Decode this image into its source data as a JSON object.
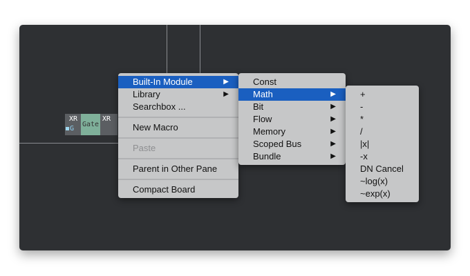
{
  "module": {
    "left_label": "XR",
    "left_port": "G",
    "center_label": "Gate",
    "right_label": "XR"
  },
  "menu1": {
    "items": [
      {
        "label": "Built-In Module",
        "submenu": true,
        "highlighted": true
      },
      {
        "label": "Library",
        "submenu": true
      },
      {
        "label": "Searchbox ..."
      },
      {
        "label": "New Macro"
      },
      {
        "label": "Paste",
        "disabled": true
      },
      {
        "label": "Parent in Other Pane"
      },
      {
        "label": "Compact Board"
      }
    ]
  },
  "menu2": {
    "items": [
      {
        "label": "Const"
      },
      {
        "label": "Math",
        "submenu": true,
        "highlighted": true
      },
      {
        "label": "Bit",
        "submenu": true
      },
      {
        "label": "Flow",
        "submenu": true
      },
      {
        "label": "Memory",
        "submenu": true
      },
      {
        "label": "Scoped Bus",
        "submenu": true
      },
      {
        "label": "Bundle",
        "submenu": true
      }
    ]
  },
  "menu3": {
    "items": [
      "+",
      "-",
      "*",
      "/",
      "|x|",
      "-x",
      "DN Cancel",
      "~log(x)",
      "~exp(x)"
    ]
  },
  "arrow": "▶"
}
